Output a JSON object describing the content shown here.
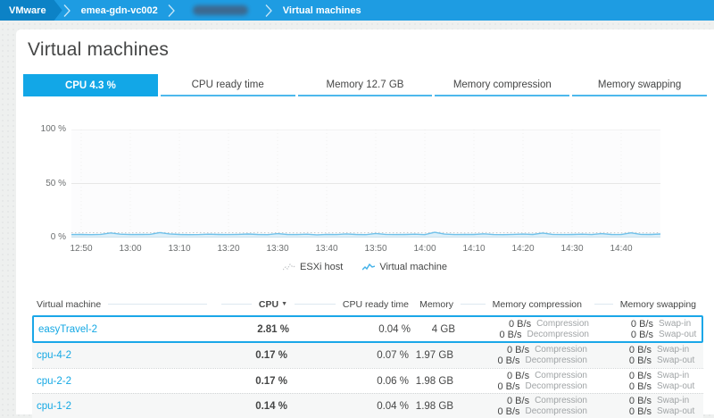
{
  "colors": {
    "topbar": "#1e9ce2",
    "topbar_root_segment": "#0c82c6",
    "accent_blue": "#14a8e4",
    "active_tab": "#12a7e7",
    "highlight_border": "#1aa7e8",
    "vm_line": "#6fc1ea",
    "esxi_line": "#c4c7c9",
    "text": "#454646",
    "muted_text": "#a0a4a6"
  },
  "breadcrumb": {
    "items": [
      {
        "label": "VMware"
      },
      {
        "label": "emea-gdn-vc002"
      },
      {
        "label": "",
        "redacted": true
      },
      {
        "label": "Virtual machines"
      }
    ]
  },
  "page": {
    "title": "Virtual machines"
  },
  "tabs": [
    {
      "label": "CPU 4.3 %",
      "active": true
    },
    {
      "label": "CPU ready time",
      "active": false
    },
    {
      "label": "Memory 12.7 GB",
      "active": false
    },
    {
      "label": "Memory compression",
      "active": false
    },
    {
      "label": "Memory swapping",
      "active": false
    }
  ],
  "chart_data": {
    "type": "line",
    "ylim": [
      0,
      100
    ],
    "grid": true,
    "legend_position": "bottom",
    "x_range_minutes": 120,
    "x_tick_minutes": [
      2,
      12,
      22,
      32,
      42,
      52,
      62,
      72,
      82,
      92,
      102,
      112
    ],
    "x_tick_labels": [
      "12:50",
      "13:00",
      "13:10",
      "13:20",
      "13:30",
      "13:40",
      "13:50",
      "14:00",
      "14:10",
      "14:20",
      "14:30",
      "14:40"
    ],
    "y_ticks": [
      {
        "value": 0,
        "label": "0 %"
      },
      {
        "value": 50,
        "label": "50 %"
      },
      {
        "value": 100,
        "label": "100 %"
      }
    ],
    "series": [
      {
        "name": "ESXi host",
        "style": "dotted",
        "color": "#c4c7c9",
        "values": [
          4.5,
          4.4,
          4.6,
          4.4,
          4.7,
          4.5,
          4.4,
          4.6,
          4.5,
          4.8,
          4.5,
          4.4,
          4.5,
          4.6,
          4.4,
          4.5,
          4.6,
          4.4,
          4.5,
          4.7,
          4.4,
          4.6,
          4.5,
          4.4,
          4.6,
          4.5,
          4.4,
          4.5,
          4.6,
          4.4,
          4.5,
          4.7,
          4.5,
          4.4,
          4.6,
          4.5,
          4.4,
          5.0,
          4.6,
          4.5,
          4.4,
          4.5,
          4.7,
          4.4,
          4.5,
          4.6,
          4.4,
          4.5,
          4.8,
          4.5,
          4.4,
          4.6,
          4.5,
          4.4,
          4.7,
          4.5,
          4.4,
          4.9,
          4.5,
          4.4,
          4.6
        ]
      },
      {
        "name": "Virtual machine",
        "style": "solid",
        "color": "#6fc1ea",
        "fill": "rgba(111,197,238,0.22)",
        "values": [
          2.8,
          2.9,
          2.7,
          3.0,
          4.3,
          3.1,
          2.8,
          2.9,
          3.0,
          4.6,
          3.4,
          2.9,
          2.7,
          2.8,
          3.1,
          2.9,
          2.8,
          3.0,
          3.3,
          2.9,
          2.7,
          3.6,
          2.9,
          2.8,
          3.1,
          2.6,
          3.0,
          2.8,
          3.4,
          2.9,
          2.7,
          3.8,
          3.0,
          2.8,
          2.9,
          3.1,
          2.7,
          4.9,
          3.2,
          2.8,
          3.0,
          2.9,
          3.5,
          2.8,
          2.7,
          3.0,
          3.2,
          2.9,
          4.2,
          3.0,
          2.8,
          2.9,
          3.1,
          2.8,
          3.6,
          2.9,
          2.8,
          4.4,
          3.0,
          2.9,
          3.3
        ]
      }
    ]
  },
  "legend": [
    {
      "label": "ESXi host"
    },
    {
      "label": "Virtual machine"
    }
  ],
  "table": {
    "sort_icon": "▼",
    "columns": [
      {
        "label": "Virtual machine"
      },
      {
        "label": "CPU",
        "sorted": "desc"
      },
      {
        "label": "CPU ready time"
      },
      {
        "label": "Memory"
      },
      {
        "label": "Memory compression"
      },
      {
        "label": "Memory swapping"
      }
    ],
    "rows": [
      {
        "name": "easyTravel-2",
        "cpu": "2.81 %",
        "cpu_ready": "0.04 %",
        "memory": "4 GB",
        "comp_val": "0 B/s",
        "comp_label": "Compression",
        "decomp_val": "0 B/s",
        "decomp_label": "Decompression",
        "swapin_val": "0 B/s",
        "swapin_label": "Swap-in",
        "swapout_val": "0 B/s",
        "swapout_label": "Swap-out",
        "highlighted": true
      },
      {
        "name": "cpu-4-2",
        "cpu": "0.17 %",
        "cpu_ready": "0.07 %",
        "memory": "1.97 GB",
        "comp_val": "0 B/s",
        "comp_label": "Compression",
        "decomp_val": "0 B/s",
        "decomp_label": "Decompression",
        "swapin_val": "0 B/s",
        "swapin_label": "Swap-in",
        "swapout_val": "0 B/s",
        "swapout_label": "Swap-out",
        "highlighted": false
      },
      {
        "name": "cpu-2-2",
        "cpu": "0.17 %",
        "cpu_ready": "0.06 %",
        "memory": "1.98 GB",
        "comp_val": "0 B/s",
        "comp_label": "Compression",
        "decomp_val": "0 B/s",
        "decomp_label": "Decompression",
        "swapin_val": "0 B/s",
        "swapin_label": "Swap-in",
        "swapout_val": "0 B/s",
        "swapout_label": "Swap-out",
        "highlighted": false
      },
      {
        "name": "cpu-1-2",
        "cpu": "0.14 %",
        "cpu_ready": "0.04 %",
        "memory": "1.98 GB",
        "comp_val": "0 B/s",
        "comp_label": "Compression",
        "decomp_val": "0 B/s",
        "decomp_label": "Decompression",
        "swapin_val": "0 B/s",
        "swapin_label": "Swap-in",
        "swapout_val": "0 B/s",
        "swapout_label": "Swap-out",
        "highlighted": false
      }
    ]
  }
}
